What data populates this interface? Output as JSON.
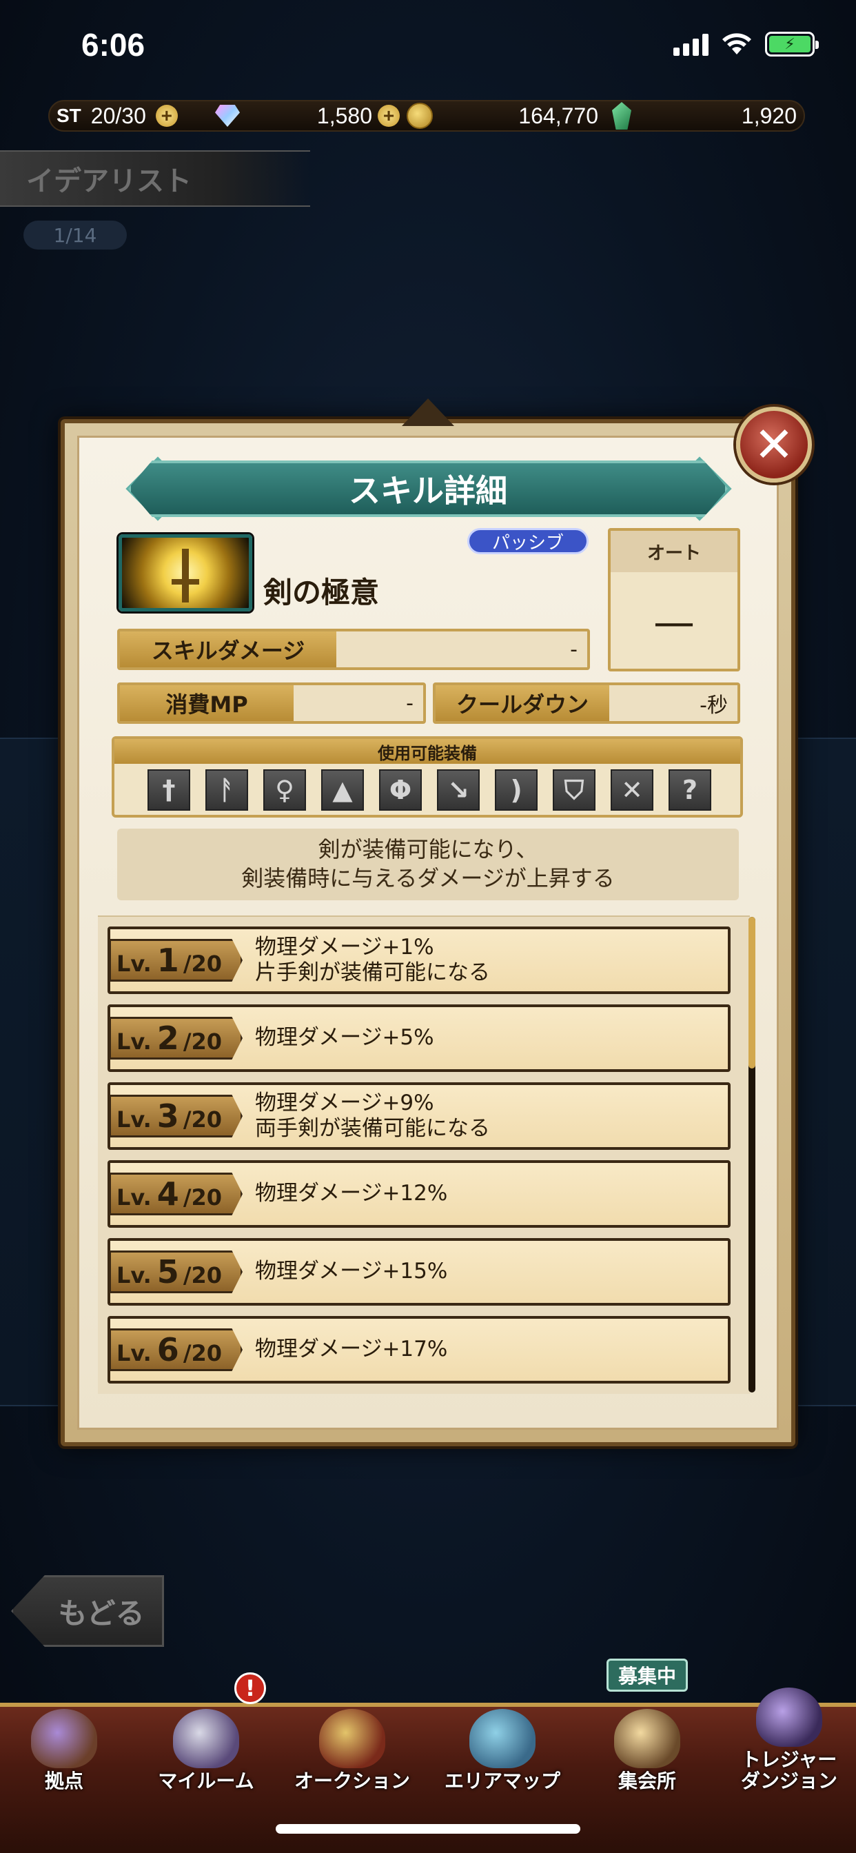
{
  "status_bar": {
    "time": "6:06"
  },
  "resources": {
    "stamina_label": "ST",
    "stamina": "20/30",
    "gems": "1,580",
    "gold": "164,770",
    "emeralds": "1,920"
  },
  "background": {
    "title": "イデアリスト",
    "page": "1/14",
    "back_label": "もどる"
  },
  "modal": {
    "title": "スキル詳細",
    "skill_name": "剣の極意",
    "type_badge": "パッシブ",
    "auto_label": "オート",
    "auto_value": "—",
    "damage_label": "スキルダメージ",
    "damage_value": "-",
    "mp_label": "消費MP",
    "mp_value": "-",
    "cooldown_label": "クールダウン",
    "cooldown_value": "-秒",
    "equip_header": "使用可能装備",
    "equip_icons": [
      "sword-icon",
      "axe-icon",
      "staff-icon",
      "dagger-icon",
      "battle-axe-icon",
      "spear-icon",
      "bow-icon",
      "shield-icon",
      "dual-swords-icon",
      "unknown-icon"
    ],
    "description_line1": "剣が装備可能になり、",
    "description_line2": "剣装備時に与えるダメージが上昇する",
    "levels": [
      {
        "prefix": "Lv.",
        "num": "1",
        "max": "/20",
        "line1": "物理ダメージ+1%",
        "line2": "片手剣が装備可能になる"
      },
      {
        "prefix": "Lv.",
        "num": "2",
        "max": "/20",
        "line1": "物理ダメージ+5%",
        "line2": ""
      },
      {
        "prefix": "Lv.",
        "num": "3",
        "max": "/20",
        "line1": "物理ダメージ+9%",
        "line2": "両手剣が装備可能になる"
      },
      {
        "prefix": "Lv.",
        "num": "4",
        "max": "/20",
        "line1": "物理ダメージ+12%",
        "line2": ""
      },
      {
        "prefix": "Lv.",
        "num": "5",
        "max": "/20",
        "line1": "物理ダメージ+15%",
        "line2": ""
      },
      {
        "prefix": "Lv.",
        "num": "6",
        "max": "/20",
        "line1": "物理ダメージ+17%",
        "line2": ""
      }
    ]
  },
  "nav": {
    "items": [
      {
        "label": "拠点",
        "icon": "base-icon"
      },
      {
        "label": "マイルーム",
        "icon": "my-room-icon"
      },
      {
        "label": "オークション",
        "icon": "auction-icon"
      },
      {
        "label": "エリアマップ",
        "icon": "area-map-icon"
      },
      {
        "label": "集会所",
        "icon": "meeting-hall-icon"
      },
      {
        "label": "トレジャーダンジョン",
        "label_line1": "トレジャー",
        "label_line2": "ダンジョン",
        "icon": "treasure-dungeon-icon"
      }
    ],
    "notify_badge": "!",
    "recruit_badge": "募集中"
  }
}
